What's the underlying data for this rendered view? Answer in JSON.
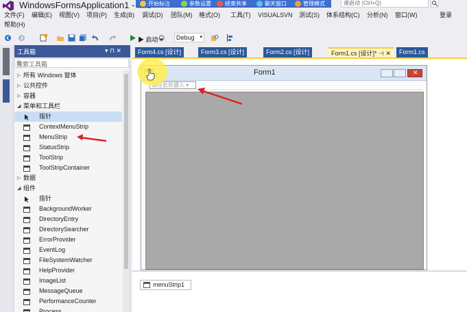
{
  "window": {
    "title": "WindowsFormsApplication1 - Mic",
    "quick_launch_placeholder": "速启动 (Ctrl+Q)"
  },
  "recording_toolbar": [
    {
      "label": "开始标注",
      "color": "#f5c33b"
    },
    {
      "label": "参数设置",
      "color": "#8fd14f"
    },
    {
      "label": "结束共享",
      "color": "#e85d4a"
    },
    {
      "label": "聊天窗口",
      "color": "#5bc0eb"
    },
    {
      "label": "管理模式",
      "color": "#f0a030"
    }
  ],
  "menu": {
    "items": [
      "文件(F)",
      "编辑(E)",
      "视图(V)",
      "项目(P)",
      "生成(B)",
      "调试(D)",
      "团队(M)",
      "格式(O)",
      "工具(T)",
      "VISUALSVN",
      "测试(S)",
      "体系结构(C)",
      "分析(N)",
      "窗口(W)"
    ],
    "help": "帮助(H)",
    "login": "登录"
  },
  "toolbar": {
    "start_label": "▶ 启动 ▾",
    "config": "Debug"
  },
  "toolbox": {
    "title": "工具箱",
    "pin_label": "▾ ⊓ ✕",
    "search_placeholder": "搜索工具箱",
    "rows": [
      {
        "kind": "cat",
        "arrow": "▷",
        "label": "所有 Windows 窗体"
      },
      {
        "kind": "cat",
        "arrow": "▷",
        "label": "公共控件"
      },
      {
        "kind": "cat",
        "arrow": "▷",
        "label": "容器"
      },
      {
        "kind": "cat",
        "arrow": "◢",
        "label": "菜单和工具栏"
      },
      {
        "kind": "item",
        "label": "指针",
        "icon": "pointer-icon",
        "selected": true
      },
      {
        "kind": "item",
        "label": "ContextMenuStrip",
        "icon": "context-menu-icon"
      },
      {
        "kind": "item",
        "label": "MenuStrip",
        "icon": "menustrip-icon"
      },
      {
        "kind": "item",
        "label": "StatusStrip",
        "icon": "statusstrip-icon"
      },
      {
        "kind": "item",
        "label": "ToolStrip",
        "icon": "toolstrip-icon"
      },
      {
        "kind": "item",
        "label": "ToolStripContainer",
        "icon": "toolstrip-container-icon"
      },
      {
        "kind": "cat",
        "arrow": "▷",
        "label": "数据"
      },
      {
        "kind": "cat",
        "arrow": "◢",
        "label": "组件"
      },
      {
        "kind": "item",
        "label": "指针",
        "icon": "pointer-icon"
      },
      {
        "kind": "item",
        "label": "BackgroundWorker",
        "icon": "backgroundworker-icon"
      },
      {
        "kind": "item",
        "label": "DirectoryEntry",
        "icon": "directoryentry-icon"
      },
      {
        "kind": "item",
        "label": "DirectorySearcher",
        "icon": "directorysearcher-icon"
      },
      {
        "kind": "item",
        "label": "ErrorProvider",
        "icon": "errorprovider-icon"
      },
      {
        "kind": "item",
        "label": "EventLog",
        "icon": "eventlog-icon"
      },
      {
        "kind": "item",
        "label": "FileSystemWatcher",
        "icon": "filesystemwatcher-icon"
      },
      {
        "kind": "item",
        "label": "HelpProvider",
        "icon": "helpprovider-icon"
      },
      {
        "kind": "item",
        "label": "ImageList",
        "icon": "imagelist-icon"
      },
      {
        "kind": "item",
        "label": "MessageQueue",
        "icon": "messagequeue-icon"
      },
      {
        "kind": "item",
        "label": "PerformanceCounter",
        "icon": "performancecounter-icon"
      },
      {
        "kind": "item",
        "label": "Process",
        "icon": "process-icon"
      }
    ]
  },
  "doc_tabs": [
    {
      "label": "Form4.cs [设计]",
      "active": false
    },
    {
      "label": "Form3.cs [设计]",
      "active": false
    },
    {
      "label": "Form2.cs [设计]",
      "active": false
    },
    {
      "label": "Form1.cs [设计]*  ⊣ ✕",
      "active": true
    },
    {
      "label": "Form1.cs",
      "active": false
    }
  ],
  "designer": {
    "form_title": "Form1",
    "menu_placeholder": "请在此处键入 ▾",
    "tray_component": "menuStrip1"
  },
  "colors": {
    "accent": "#f5cc3c",
    "panel_header": "#3b5998",
    "tab_inactive": "#2b579a",
    "client_area": "#a9a9a9",
    "annotation_arrow": "#e02020"
  }
}
